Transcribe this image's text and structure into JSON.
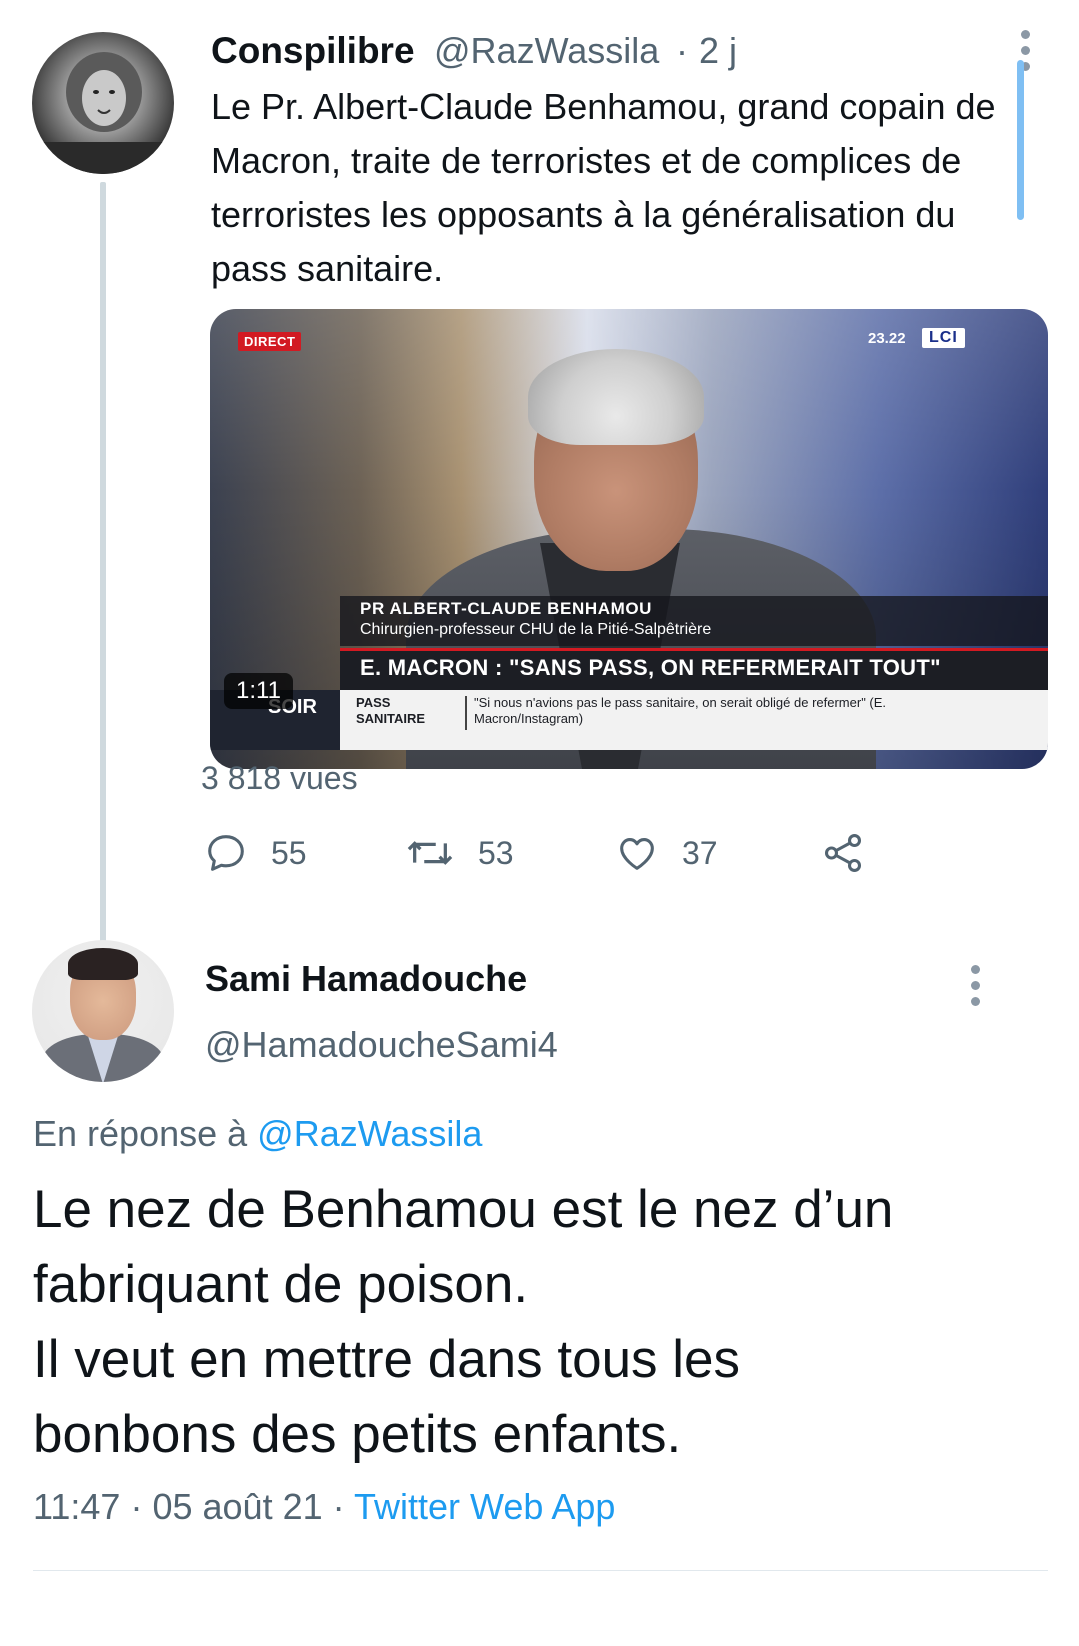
{
  "parent_tweet": {
    "display_name": "Conspilibre",
    "handle": "@RazWassila",
    "separator": "·",
    "time": "2 j",
    "text": "Le Pr. Albert-Claude Benhamou, grand copain de Macron, traite de terroristes et de complices de terroristes les opposants à la généralisation du pass sanitaire.",
    "video": {
      "badge": "DIRECT",
      "clock": "23.22",
      "channel": "LCI",
      "lower_third_name": "PR ALBERT-CLAUDE BENHAMOU",
      "lower_third_role": "Chirurgien-professeur CHU de la Pitié-Salpêtrière",
      "headline": "E. MACRON : \"SANS PASS, ON REFERMERAIT TOUT\"",
      "ticker_label": "PASS SANITAIRE",
      "ticker_text": "\"Si nous n'avions pas le pass sanitaire, on serait obligé de refermer\" (E. Macron/Instagram)",
      "show_logo": "SOIR",
      "duration": "1:11"
    },
    "views": "3 818 vues",
    "stats": {
      "replies": "55",
      "retweets": "53",
      "likes": "37"
    }
  },
  "reply_tweet": {
    "display_name": "Sami Hamadouche",
    "handle": "@HamadoucheSami4",
    "reply_prefix": "En réponse à",
    "reply_mention": "@RazWassila",
    "text_lines": [
      "Le nez de Benhamou est le nez d’un",
      "fabriquant de poison.",
      "Il veut en mettre dans tous les",
      "bonbons des petits enfants."
    ],
    "time": "11:47",
    "separator": "·",
    "date": "05 août 21",
    "separator2": "·",
    "app": "Twitter Web App"
  },
  "colors": {
    "text": "#0f1419",
    "secondary": "#536471",
    "accent": "#1d9bf0",
    "thread_line": "#cfd9de"
  }
}
